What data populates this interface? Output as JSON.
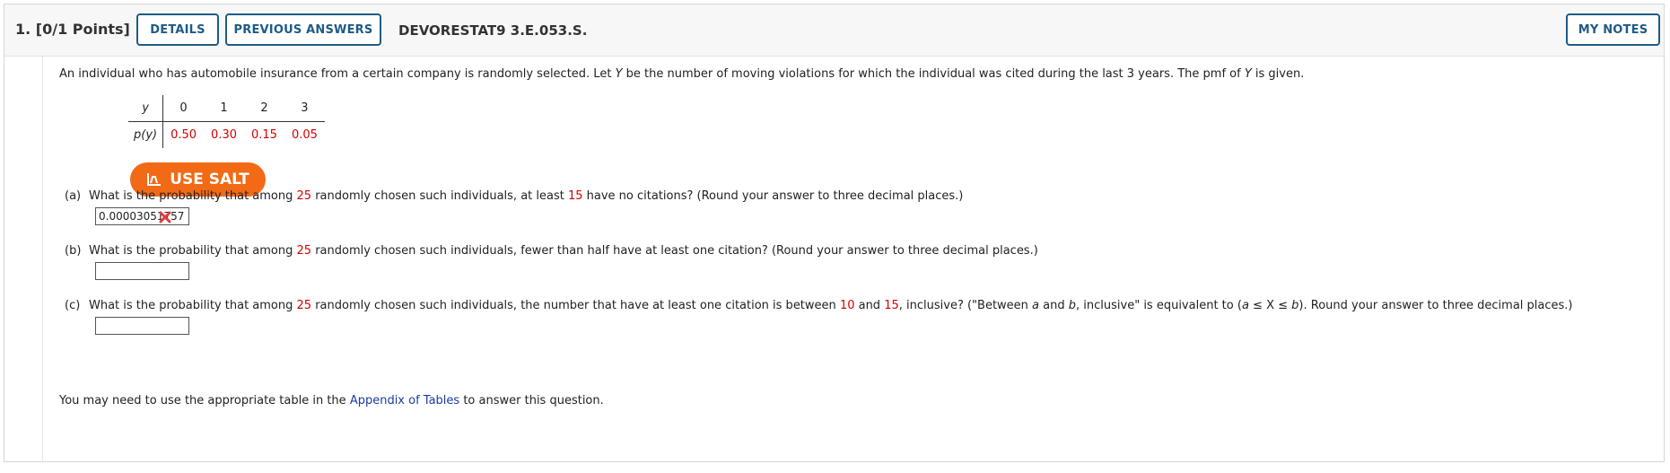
{
  "header": {
    "question_number": "1.",
    "points": "[0/1 Points]",
    "details_label": "DETAILS",
    "previous_answers_label": "PREVIOUS ANSWERS",
    "assignment_code": "DEVORESTAT9 3.E.053.S.",
    "my_notes_label": "MY NOTES"
  },
  "intro": {
    "part1": "An individual who has automobile insurance from a certain company is randomly selected. Let ",
    "var_Y": "Y",
    "part2": " be the number of moving violations for which the individual was cited during the last 3 years. The pmf of ",
    "part3": " is given."
  },
  "pmf_table": {
    "y_label": "y",
    "py_label": "p(y)",
    "y_values": [
      "0",
      "1",
      "2",
      "3"
    ],
    "p_values": [
      "0.50",
      "0.30",
      "0.15",
      "0.05"
    ]
  },
  "salt_button": {
    "label": "USE SALT"
  },
  "parts": {
    "a": {
      "label": "(a)",
      "t1": "What is the probability that among ",
      "n": "25",
      "t2": " randomly chosen such individuals, at least ",
      "k": "15",
      "t3": " have no citations? (Round your answer to three decimal places.)",
      "answer_value": "0.00003051757",
      "status": "incorrect"
    },
    "b": {
      "label": "(b)",
      "t1": "What is the probability that among ",
      "n": "25",
      "t2": " randomly chosen such individuals, fewer than half have at least one citation? (Round your answer to three decimal places.)",
      "answer_value": ""
    },
    "c": {
      "label": "(c)",
      "t1": "What is the probability that among ",
      "n": "25",
      "t2": " randomly chosen such individuals, the number that have at least one citation is between ",
      "lo": "10",
      "t3": " and ",
      "hi": "15",
      "t4": ", inclusive? (\"Between ",
      "a": "a",
      "t5": " and ",
      "b": "b",
      "t6": ", inclusive\" is equivalent to (",
      "t7": " ≤ X ≤ ",
      "t8": "). Round your answer to three decimal places.)",
      "answer_value": ""
    }
  },
  "footer": {
    "t1": "You may need to use the appropriate table in the ",
    "link": "Appendix of Tables",
    "t2": " to answer this question."
  },
  "colors": {
    "accent_blue": "#1f5b85",
    "salt_orange": "#f26a16",
    "highlight_red": "#d60000",
    "link_blue": "#1a3ca6"
  }
}
